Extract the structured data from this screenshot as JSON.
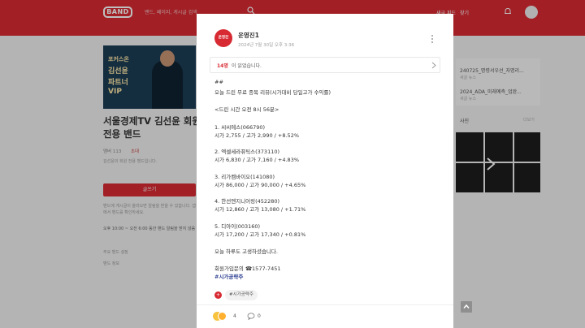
{
  "header": {
    "logo": "BAND",
    "search_placeholder": "밴드, 페이지, 게시글 검색",
    "nav_1": "새글 피드",
    "nav_2": "찾기"
  },
  "sidebar": {
    "cover_lines": [
      "포커스온",
      "김선윤",
      "파트너",
      "VIP"
    ],
    "band_title": "서울경제TV 김선윤 회원전용 밴드",
    "member_count": "멤버 113",
    "invite": "초대",
    "description": "김선윤의 회원 전용 밴드입니다.",
    "write_button": "글쓰기",
    "notice": "밴드에 게시글이 올라오면 알림을 받을 수 있습니다. 앱에서 밴드를 확인하세요.",
    "time_info": "오후 10:00 ~ 오전 6:00 동안 밴드 알림을 받지 않음",
    "link_1": "주요 밴드 설정",
    "link_2": "밴드 정보"
  },
  "right_panel": {
    "items": [
      {
        "title": "240725_명령서우선_자명리...",
        "sub": "새글 뉴스"
      },
      {
        "title": "2024_ADA_미래예측_업완...",
        "sub": "새글 뉴스"
      }
    ],
    "photos_label": "사진",
    "photos_more": "더보기"
  },
  "post": {
    "author": "운영진1",
    "avatar_text": "운영진",
    "date": "2024년 7월 30일 오후 3:36",
    "read_count": "14명",
    "read_label": "이 읽었습니다.",
    "lines": [
      "##",
      "오늘 드린 무료 종목 리뷰(시가대비 당일고가 수익률)",
      "<드린 시간 오전 8시 56분>",
      "1. 씨씨에스(066790)",
      "시가 2,755 / 고가 2,990 / +8.52%",
      "2. 엑셀세라퓨틱스(373110)",
      "시가 6,830 / 고가 7,160 / +4.83%",
      "3. 리가켐바이오(141080)",
      "시가 86,000 / 고가 90,000 / +4.65%",
      "4. 한선엔지니어링(452280)",
      "시가 12,860 / 고가 13,080 / +1.71%",
      "5. 디아이(003160)",
      "시가 17,200 / 고가 17,340 / +0.81%",
      "오늘 하루도 고생하셨습니다.",
      "회원가입문의 ☎1577-7451"
    ],
    "hashtag": "#시가공략주",
    "tag": "#시가공략주",
    "tag_plus": "+",
    "like_count": "4",
    "comment_count": "0"
  }
}
